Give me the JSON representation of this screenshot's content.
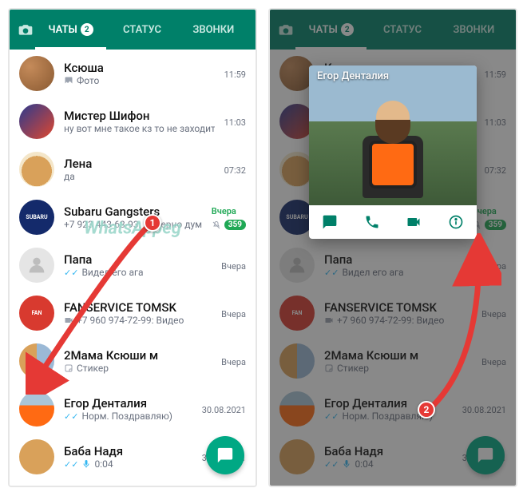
{
  "header": {
    "tab_chats": "ЧАТЫ",
    "tab_status": "СТАТУС",
    "tab_calls": "ЗВОНКИ",
    "chats_badge": "2"
  },
  "chats": [
    {
      "name": "Ксюша",
      "sub": "Фото",
      "sub_icon": "photo",
      "time": "11:59",
      "avatar": "av-photo"
    },
    {
      "name": "Мистер Шифон",
      "sub": "ну вот мне такое кз то не заходит, мне…",
      "time": "11:03",
      "avatar": "av-grad"
    },
    {
      "name": "Лена",
      "sub": "да",
      "time": "07:32",
      "avatar": "av-hamster"
    },
    {
      "name": "Subaru Gangsters",
      "sub": "+7 923 443-63-93: Наверно дума…",
      "time": "Вчера",
      "unread": "359",
      "muted": true,
      "unread_time": true,
      "avatar": "av-text",
      "avatar_text": "SUBARU"
    },
    {
      "name": "Папа",
      "sub": "Видел его ага",
      "ticks": true,
      "time": "Вчера",
      "avatar": "av-none"
    },
    {
      "name": "FANSERVICE TOMSK",
      "sub": "+7 960 974-72-99: ",
      "sub_icon": "video",
      "sub_after": "Видео",
      "time": "Вчера",
      "avatar": "av-red",
      "avatar_text": "FAN"
    },
    {
      "name": "2Мама Ксюши м",
      "sub": "Стикер",
      "sub_icon": "sticker",
      "time": "Вчера",
      "avatar": "av-duo"
    },
    {
      "name": "Егор Денталия",
      "sub": "Норм. Поздравляю)",
      "ticks": true,
      "time": "30.08.2021",
      "avatar": "av-man"
    },
    {
      "name": "Баба Надя",
      "sub": "0:04",
      "sub_icon": "mic",
      "ticks_blue": true,
      "time": "30.08.2021",
      "avatar": "av-woman"
    }
  ],
  "right_overlay": {
    "title": "Егор Денталия"
  },
  "right_papa_alt": "Папа",
  "badges": {
    "b1": "1",
    "b2": "2"
  },
  "watermark": "WhatsAppeg"
}
